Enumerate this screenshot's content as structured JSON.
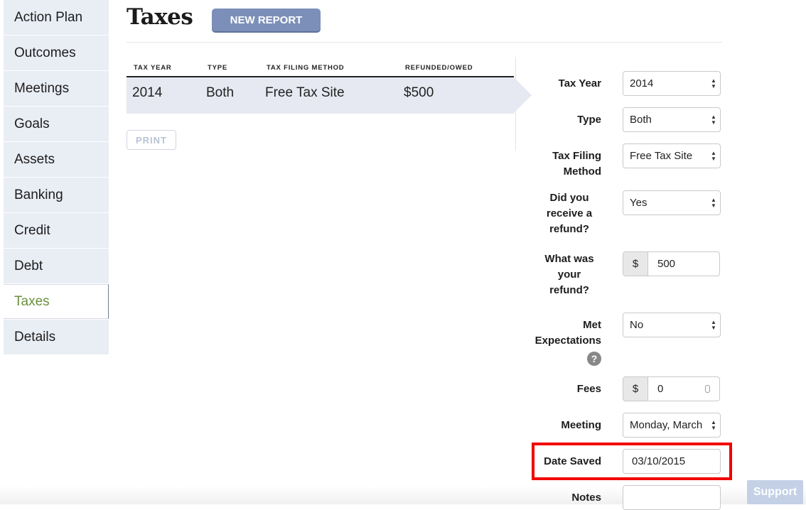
{
  "sidebar": {
    "items": [
      {
        "label": "Action Plan"
      },
      {
        "label": "Outcomes"
      },
      {
        "label": "Meetings"
      },
      {
        "label": "Goals"
      },
      {
        "label": "Assets"
      },
      {
        "label": "Banking"
      },
      {
        "label": "Credit"
      },
      {
        "label": "Debt"
      },
      {
        "label": "Taxes",
        "active": true
      },
      {
        "label": "Details"
      }
    ],
    "active_color": "#6b8f3e"
  },
  "header": {
    "title": "Taxes",
    "new_report_label": "NEW REPORT"
  },
  "table": {
    "columns": [
      "TAX YEAR",
      "TYPE",
      "TAX FILING METHOD",
      "REFUNDED/OWED"
    ],
    "rows": [
      [
        "2014",
        "Both",
        "Free Tax Site",
        "$500"
      ]
    ],
    "print_label": "PRINT"
  },
  "form": {
    "tax_year": {
      "label": "Tax Year",
      "value": "2014"
    },
    "type": {
      "label": "Type",
      "value": "Both"
    },
    "filing_method": {
      "label": "Tax Filing Method",
      "value": "Free Tax Site"
    },
    "received_refund": {
      "label": "Did you receive a refund?",
      "value": "Yes"
    },
    "refund_amount": {
      "label": "What was your refund?",
      "prefix": "$",
      "value": "500"
    },
    "met_expectations": {
      "label": "Met Expectations",
      "value": "No",
      "help": "?"
    },
    "fees": {
      "label": "Fees",
      "prefix": "$",
      "value": "0"
    },
    "meeting": {
      "label": "Meeting",
      "value": "Monday, March"
    },
    "date_saved": {
      "label": "Date Saved",
      "value": "03/10/2015"
    },
    "notes": {
      "label": "Notes",
      "value": ""
    }
  },
  "support_label": "Support",
  "colors": {
    "button": "#7b8fb8",
    "highlight": "#f20000",
    "row_bg": "#e6e9f1"
  }
}
